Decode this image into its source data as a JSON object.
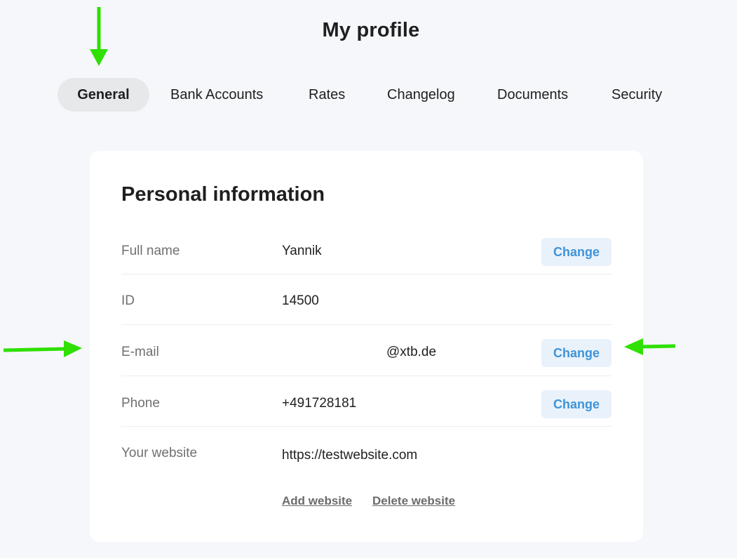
{
  "page": {
    "title": "My profile"
  },
  "tabs": [
    {
      "label": "General",
      "active": true
    },
    {
      "label": "Bank Accounts",
      "active": false
    },
    {
      "label": "Rates",
      "active": false
    },
    {
      "label": "Changelog",
      "active": false
    },
    {
      "label": "Documents",
      "active": false
    },
    {
      "label": "Security",
      "active": false
    }
  ],
  "personal_info": {
    "title": "Personal information",
    "rows": [
      {
        "label": "Full name",
        "value": "Yannik",
        "action": "Change"
      },
      {
        "label": "ID",
        "value": "14500"
      },
      {
        "label": "E-mail",
        "value": "@xtb.de",
        "action": "Change"
      },
      {
        "label": "Phone",
        "value": "+491728181",
        "action": "Change"
      },
      {
        "label": "Your website",
        "value": "https://testwebsite.com"
      }
    ],
    "website_actions": {
      "add": "Add website",
      "delete": "Delete website"
    }
  },
  "colors": {
    "background": "#f5f7fa",
    "card": "#ffffff",
    "active_tab": "#e7e8ea",
    "button_bg": "#e9f2fb",
    "button_text": "#3f93d8",
    "annotation_arrow": "#2fe000"
  },
  "annotations": [
    {
      "icon": "arrow-down-icon",
      "target": "General tab"
    },
    {
      "icon": "arrow-right-icon",
      "target": "E-mail label"
    },
    {
      "icon": "arrow-left-icon",
      "target": "E-mail Change button"
    }
  ]
}
